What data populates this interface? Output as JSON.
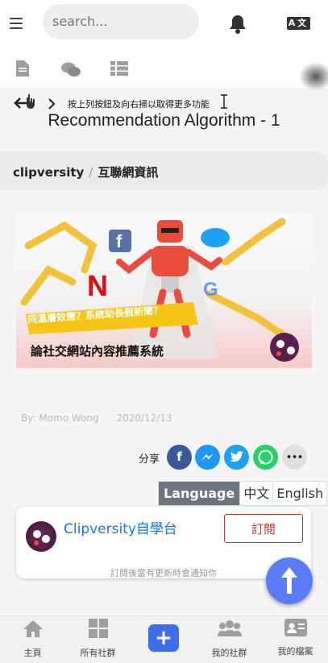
{
  "header": {
    "search_placeholder": "search...",
    "lang_icon": "A文"
  },
  "tabs": [
    "document-icon",
    "chat-icon",
    "list-icon"
  ],
  "hint": {
    "text": "按上列按鈕及向右掃以取得更多功能"
  },
  "article": {
    "title": "Recommendation Algorithm - 1",
    "breadcrumb": [
      "clipversity",
      "互聯網資訊"
    ],
    "hero_banner": "同溫層效應？系統助長假新聞？",
    "hero_caption": "論社交網站內容推薦系統",
    "author": "By: Momo Wong",
    "date": "2020/12/13"
  },
  "share": {
    "label": "分享",
    "buttons": [
      {
        "name": "facebook",
        "glyph": "f",
        "color": "#3b5998"
      },
      {
        "name": "messenger",
        "glyph": "m",
        "color": "#2196f3"
      },
      {
        "name": "twitter",
        "glyph": "t",
        "color": "#1da1f2"
      },
      {
        "name": "whatsapp",
        "glyph": "w",
        "color": "#25d366"
      },
      {
        "name": "more",
        "glyph": "•••",
        "color": "#e0e0e0"
      }
    ]
  },
  "language": {
    "options": [
      "Language",
      "中文",
      "English"
    ]
  },
  "channel": {
    "name": "Clipversity自學台",
    "subscribe_label": "訂閱",
    "notify_text": "訂閱後當有更新時會通知你"
  },
  "bottom_nav": [
    {
      "label": "主頁",
      "icon": "home-icon"
    },
    {
      "label": "所有社群",
      "icon": "grid-icon"
    },
    {
      "label": "",
      "icon": "plus-icon"
    },
    {
      "label": "我的社群",
      "icon": "users-icon"
    },
    {
      "label": "我的檔案",
      "icon": "profile-card-icon"
    }
  ]
}
